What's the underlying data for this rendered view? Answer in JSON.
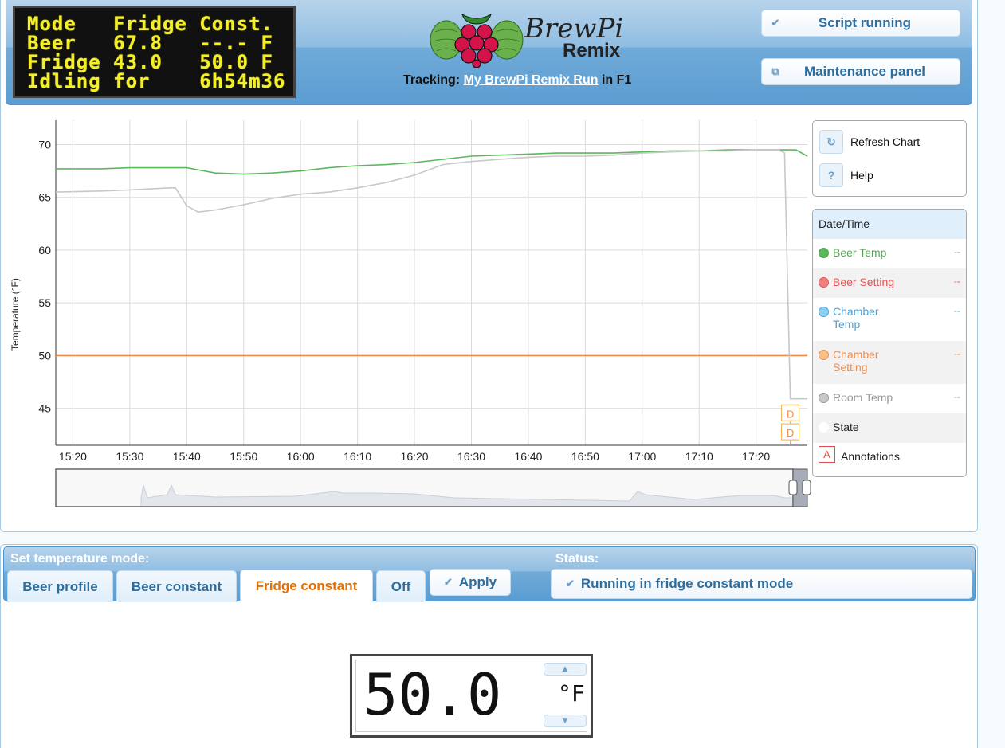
{
  "lcd": {
    "lines": [
      "Mode   Fridge Const.",
      "Beer   67.8   --.- F",
      "Fridge 43.0   50.0 F",
      "Idling for    6h54m36"
    ]
  },
  "logo": {
    "line1": "BrewPi",
    "line2": "Remix"
  },
  "tracking": {
    "prefix": "Tracking:",
    "run_name": "My BrewPi Remix Run",
    "suffix": "in F1"
  },
  "header_buttons": {
    "script": "Script running",
    "maintenance": "Maintenance panel"
  },
  "chart_data": {
    "type": "line",
    "ylabel": "Temperature (°F)",
    "x_ticks": [
      "15:20",
      "15:30",
      "15:40",
      "15:50",
      "16:00",
      "16:10",
      "16:20",
      "16:30",
      "16:40",
      "16:50",
      "17:00",
      "17:10",
      "17:20"
    ],
    "y_ticks": [
      45,
      50,
      55,
      60,
      65,
      70
    ],
    "xlim": [
      "15:17",
      "17:29"
    ],
    "ylim": [
      41.5,
      72.3
    ],
    "grid": true,
    "series": [
      {
        "name": "Beer Temp",
        "color": "#5cb85c",
        "x": [
          "15:17",
          "15:25",
          "15:30",
          "15:35",
          "15:40",
          "15:45",
          "15:50",
          "15:55",
          "16:00",
          "16:05",
          "16:10",
          "16:15",
          "16:20",
          "16:25",
          "16:30",
          "16:35",
          "16:40",
          "16:45",
          "16:50",
          "16:55",
          "17:00",
          "17:05",
          "17:10",
          "17:15",
          "17:20",
          "17:25",
          "17:27",
          "17:29"
        ],
        "y": [
          67.7,
          67.7,
          67.8,
          67.8,
          67.8,
          67.3,
          67.2,
          67.3,
          67.5,
          67.8,
          68.0,
          68.1,
          68.3,
          68.6,
          68.9,
          69.0,
          69.1,
          69.2,
          69.2,
          69.2,
          69.3,
          69.4,
          69.4,
          69.5,
          69.5,
          69.5,
          69.5,
          68.9
        ]
      },
      {
        "name": "Chamber Setting",
        "color": "#f08c4a",
        "x": [
          "15:17",
          "17:29"
        ],
        "y": [
          50.0,
          50.0
        ]
      },
      {
        "name": "Room Temp",
        "color": "#c8c8c8",
        "x": [
          "15:17",
          "15:25",
          "15:30",
          "15:37",
          "15:38",
          "15:40",
          "15:42",
          "15:45",
          "15:50",
          "15:55",
          "16:00",
          "16:05",
          "16:10",
          "16:15",
          "16:20",
          "16:25",
          "16:30",
          "16:35",
          "16:40",
          "16:45",
          "16:50",
          "16:55",
          "17:00",
          "17:05",
          "17:10",
          "17:15",
          "17:20",
          "17:24",
          "17:25",
          "17:26",
          "17:29"
        ],
        "y": [
          65.5,
          65.6,
          65.7,
          65.9,
          65.9,
          64.2,
          63.6,
          63.8,
          64.3,
          64.9,
          65.3,
          65.5,
          65.9,
          66.4,
          67.1,
          68.1,
          68.4,
          68.6,
          68.8,
          68.9,
          68.9,
          69.0,
          69.2,
          69.3,
          69.4,
          69.4,
          69.5,
          69.5,
          69.2,
          45.9,
          45.9
        ]
      }
    ],
    "annotations": [
      {
        "label": "D",
        "x": "17:26",
        "y": 44.5
      },
      {
        "label": "D",
        "x": "17:26",
        "y": 42.7
      }
    ]
  },
  "chart_side": {
    "refresh": "Refresh Chart",
    "help": "Help"
  },
  "legend": {
    "header": "Date/Time",
    "items": [
      {
        "label": "Beer Temp",
        "value": "--",
        "color": "#4fa64f",
        "dot": "#5cb85c"
      },
      {
        "label": "Beer Setting",
        "value": "--",
        "color": "#e05555",
        "dot": "#f08080"
      },
      {
        "label": "Chamber Temp",
        "value": "--",
        "color": "#4aa3d8",
        "dot": "#8ccff0"
      },
      {
        "label": "Chamber Setting",
        "value": "--",
        "color": "#f08c4a",
        "dot": "#f9c08c"
      },
      {
        "label": "Room Temp",
        "value": "--",
        "color": "#999999",
        "dot": "#c8c8c8"
      },
      {
        "label": "State",
        "value": "",
        "color": "#222222",
        "dot": "#ffffff"
      },
      {
        "label": "Annotations",
        "value": "",
        "color": "#222222",
        "dot": ""
      }
    ],
    "annotation_icon": "A"
  },
  "mode": {
    "title": "Set temperature mode:",
    "tabs": [
      "Beer profile",
      "Beer constant",
      "Fridge constant",
      "Off"
    ],
    "active": "Fridge constant",
    "apply": "Apply"
  },
  "status": {
    "title": "Status:",
    "text": "Running in fridge constant mode"
  },
  "setpoint": {
    "value": "50.0",
    "unit": "°F"
  }
}
